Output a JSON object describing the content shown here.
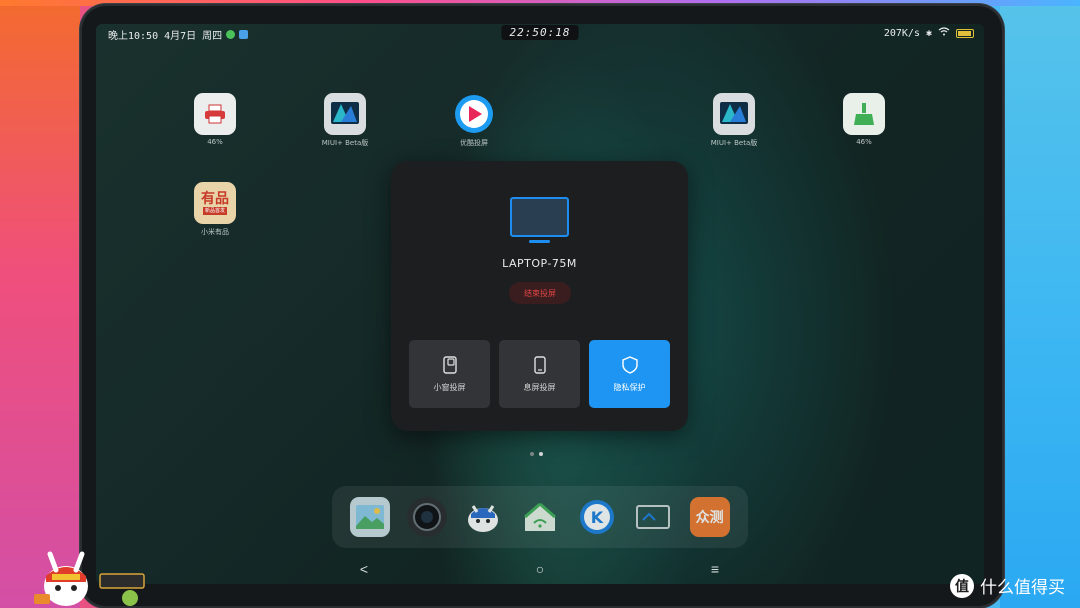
{
  "status_bar": {
    "date_text": "晚上10:50 4月7日 周四",
    "clock": "22:50:18",
    "network_speed": "207K/s"
  },
  "home_apps": [
    {
      "label": "46%",
      "icon": "printer-icon",
      "color": "#f2f2f2"
    },
    {
      "label": "MIUI+ Beta版",
      "icon": "miui-plus-icon",
      "color": "#1a6fb0"
    },
    {
      "label": "优酷投屏",
      "icon": "play-icon",
      "color": "#1d9bf0"
    },
    {
      "label": "MIUI+ Beta版",
      "icon": "miui-plus-icon",
      "color": "#1a6fb0"
    },
    {
      "label": "46%",
      "icon": "broom-icon",
      "color": "#e9efe9"
    },
    {
      "label": "小米有品",
      "icon": "youpin-icon",
      "color": "#c63a28",
      "tile_text": "有品",
      "tile_subtext": "新品首发"
    }
  ],
  "dialog": {
    "device_name": "LAPTOP-75M",
    "end_button": "结束投屏",
    "options": [
      {
        "label": "小窗投屏",
        "icon": "small-window-icon",
        "active": false
      },
      {
        "label": "息屏投屏",
        "icon": "phone-screen-off-icon",
        "active": false
      },
      {
        "label": "隐私保护",
        "icon": "shield-icon",
        "active": true
      }
    ]
  },
  "dock_apps": [
    {
      "icon": "gallery-icon"
    },
    {
      "icon": "camera-icon"
    },
    {
      "icon": "mascot-app-icon"
    },
    {
      "icon": "home-wifi-icon"
    },
    {
      "icon": "k-app-icon"
    },
    {
      "icon": "cast-screen-icon"
    },
    {
      "icon": "zhongce-icon",
      "text": "众测"
    }
  ],
  "navigation": {
    "back": "<",
    "home": "○",
    "menu": "≡"
  },
  "watermark": {
    "badge": "值",
    "text": "什么值得买"
  },
  "colors": {
    "accent": "#1f95f3",
    "danger": "#e24545",
    "dialog_bg": "#1c1e20"
  }
}
